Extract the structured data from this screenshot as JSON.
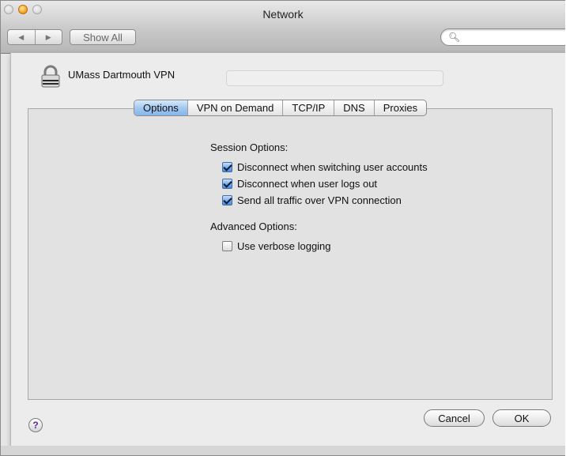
{
  "window": {
    "title": "Network"
  },
  "toolbar": {
    "back_icon": "left-triangle-icon",
    "forward_icon": "right-triangle-icon",
    "show_all_label": "Show All",
    "search_icon": "magnifier-icon",
    "search_value": "",
    "search_placeholder": ""
  },
  "sheet": {
    "connection_name": "UMass Dartmouth VPN",
    "connection_icon": "padlock-icon",
    "tabs": [
      {
        "label": "Options",
        "active": true
      },
      {
        "label": "VPN on Demand",
        "active": false
      },
      {
        "label": "TCP/IP",
        "active": false
      },
      {
        "label": "DNS",
        "active": false
      },
      {
        "label": "Proxies",
        "active": false
      }
    ],
    "session_options": {
      "heading": "Session Options:",
      "items": [
        {
          "label": "Disconnect when switching user accounts",
          "checked": true
        },
        {
          "label": "Disconnect when user logs out",
          "checked": true
        },
        {
          "label": "Send all traffic over VPN connection",
          "checked": true
        }
      ]
    },
    "advanced_options": {
      "heading": "Advanced Options:",
      "items": [
        {
          "label": "Use verbose logging",
          "checked": false
        }
      ]
    },
    "help_label": "?",
    "cancel_label": "Cancel",
    "ok_label": "OK"
  },
  "colors": {
    "active_tab": "#9fc6ef",
    "checkbox_checked": "#6ea5e6",
    "window_bg": "#e6e6e6"
  }
}
